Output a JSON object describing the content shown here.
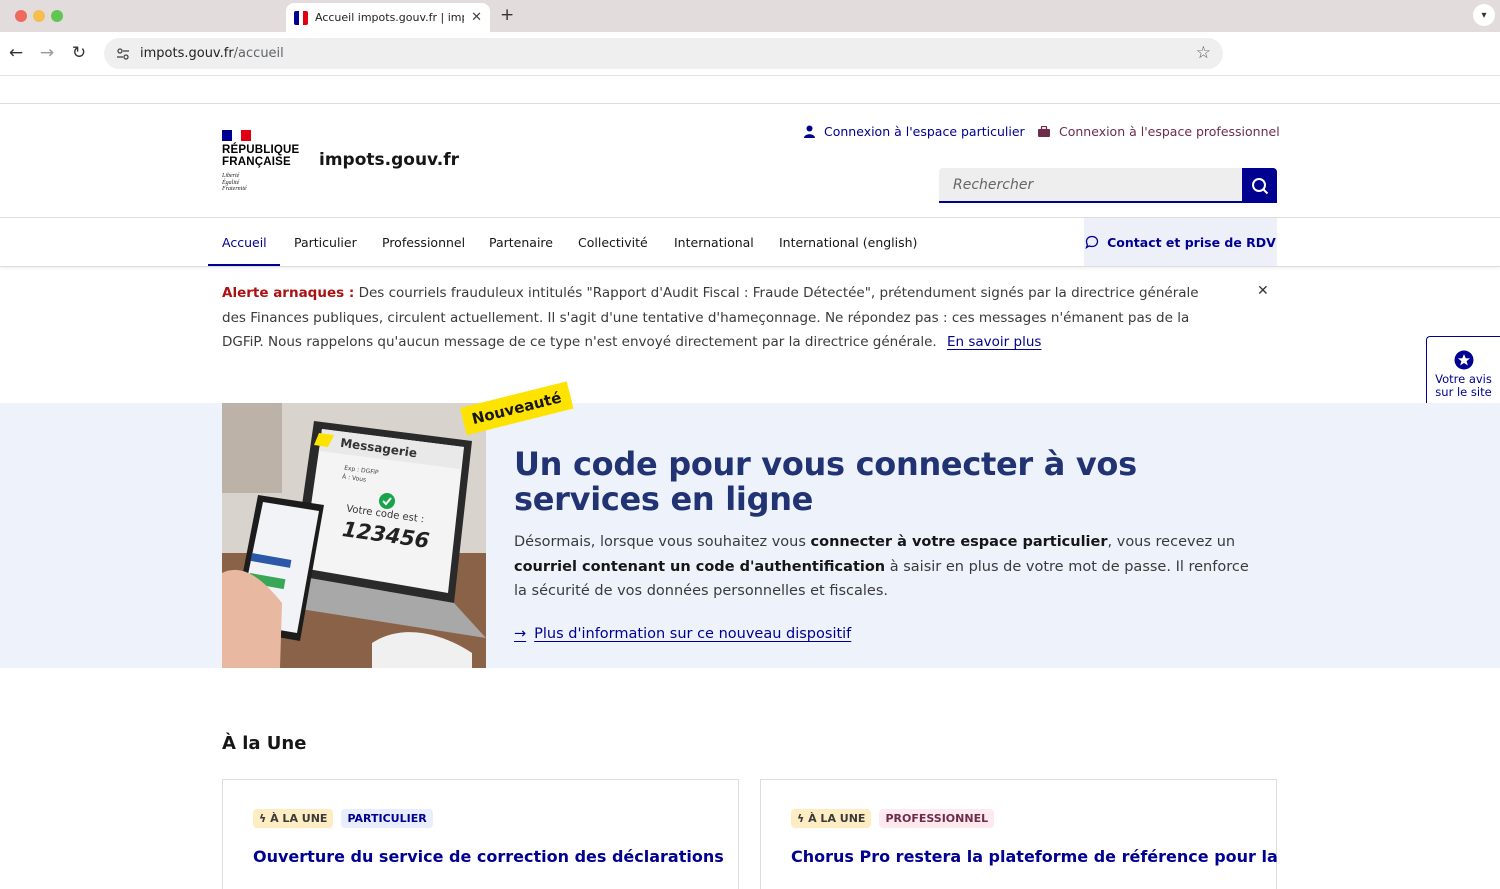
{
  "browser": {
    "tab_title": "Accueil impots.gouv.fr | impots.gouv.fr",
    "url_host": "impots.gouv.fr",
    "url_path": "/accueil"
  },
  "header": {
    "republique_line1": "RÉPUBLIQUE",
    "republique_line2": "FRANÇAISE",
    "devise1": "Liberté",
    "devise2": "Égalité",
    "devise3": "Fraternité",
    "site_name": "impots.gouv.fr",
    "connect_particulier": "Connexion à l'espace particulier",
    "connect_pro": "Connexion à l'espace professionnel",
    "search_placeholder": "Rechercher"
  },
  "nav": {
    "items": [
      "Accueil",
      "Particulier",
      "Professionnel",
      "Partenaire",
      "Collectivité",
      "International",
      "International (english)"
    ],
    "contact": "Contact et prise de RDV"
  },
  "alert": {
    "title": "Alerte arnaques :",
    "text": "Des courriels frauduleux intitulés \"Rapport d'Audit Fiscal : Fraude Détectée\", prétendument signés par la directrice générale des Finances publiques, circulent actuellement. Il s'agit d'une tentative d'hameçonnage. Ne répondez pas : ces messages n'émanent pas de la DGFiP. Nous rappelons qu'aucun message de ce type n'est envoyé directement par la directrice générale.",
    "link": "En savoir plus"
  },
  "feedback": {
    "line1": "Votre avis",
    "line2": "sur le site"
  },
  "hero": {
    "badge": "Nouveauté",
    "title_line1": "Un code pour vous connecter à vos",
    "title_line2": "services en ligne",
    "text_1": "Désormais, lorsque vous souhaitez vous ",
    "text_bold1": "connecter à votre espace particulier",
    "text_2": ", vous recevez un ",
    "text_bold2": "courriel contenant un code d'authentification",
    "text_3": " à saisir en plus de votre mot de passe. Il renforce la sécurité de vos données personnelles et fiscales.",
    "link": "Plus d'information sur ce nouveau dispositif",
    "img_messagerie": "Messagerie",
    "img_exp": "Exp : DGFiP",
    "img_to": "À : Vous",
    "img_code_label": "Votre code est :",
    "img_code": "123456"
  },
  "une": {
    "title": "À la Une",
    "cards": [
      {
        "tag1": "À LA UNE",
        "tag2": "PARTICULIER",
        "title": "Ouverture du service de correction des déclarations"
      },
      {
        "tag1": "À LA UNE",
        "tag2": "PROFESSIONNEL",
        "title": "Chorus Pro restera la plateforme de référence pour la"
      }
    ]
  },
  "colors": {
    "primary": "#000091",
    "alert_red": "#ab1212",
    "hero_bg": "#eef3fb",
    "badge_yellow": "#ffe300"
  }
}
